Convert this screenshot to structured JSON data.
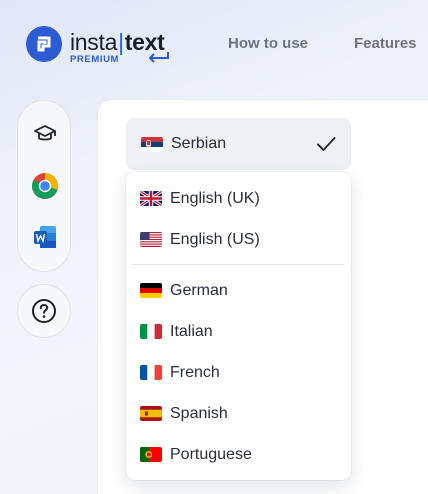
{
  "header": {
    "logo_left": "insta",
    "logo_sep": "|",
    "logo_right": "text",
    "logo_badge": "PREMIUM",
    "nav": [
      "How to use",
      "Features"
    ]
  },
  "rail": {
    "items": [
      {
        "icon": "graduation-cap-icon"
      },
      {
        "icon": "chrome-icon"
      },
      {
        "icon": "word-icon"
      }
    ],
    "help_icon": "question-circle-icon"
  },
  "language_select": {
    "selected": "Serbian",
    "selected_flag": "serbia-flag",
    "options": [
      {
        "label": "English (UK)",
        "flag": "uk-flag"
      },
      {
        "label": "English (US)",
        "flag": "us-flag"
      },
      {
        "label": "German",
        "flag": "germany-flag"
      },
      {
        "label": "Italian",
        "flag": "italy-flag"
      },
      {
        "label": "French",
        "flag": "france-flag"
      },
      {
        "label": "Spanish",
        "flag": "spain-flag"
      },
      {
        "label": "Portuguese",
        "flag": "portugal-flag"
      }
    ]
  },
  "colors": {
    "brand": "#2d5bd6",
    "text": "#2a2e38",
    "nav": "#6f7480"
  }
}
